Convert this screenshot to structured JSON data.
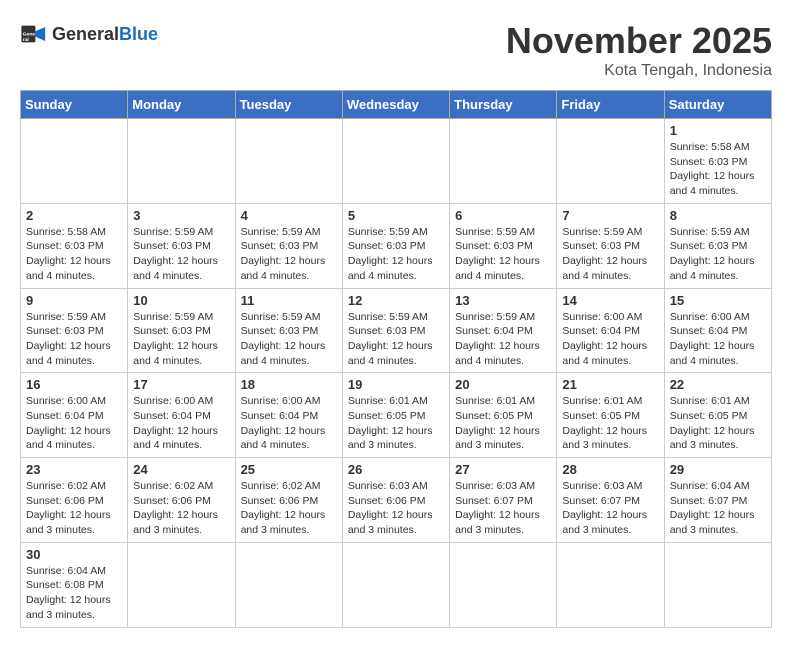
{
  "logo": {
    "text_general": "General",
    "text_blue": "Blue"
  },
  "title": "November 2025",
  "subtitle": "Kota Tengah, Indonesia",
  "days_of_week": [
    "Sunday",
    "Monday",
    "Tuesday",
    "Wednesday",
    "Thursday",
    "Friday",
    "Saturday"
  ],
  "weeks": [
    [
      {
        "day": "",
        "info": ""
      },
      {
        "day": "",
        "info": ""
      },
      {
        "day": "",
        "info": ""
      },
      {
        "day": "",
        "info": ""
      },
      {
        "day": "",
        "info": ""
      },
      {
        "day": "",
        "info": ""
      },
      {
        "day": "1",
        "info": "Sunrise: 5:58 AM\nSunset: 6:03 PM\nDaylight: 12 hours and 4 minutes."
      }
    ],
    [
      {
        "day": "2",
        "info": "Sunrise: 5:58 AM\nSunset: 6:03 PM\nDaylight: 12 hours and 4 minutes."
      },
      {
        "day": "3",
        "info": "Sunrise: 5:59 AM\nSunset: 6:03 PM\nDaylight: 12 hours and 4 minutes."
      },
      {
        "day": "4",
        "info": "Sunrise: 5:59 AM\nSunset: 6:03 PM\nDaylight: 12 hours and 4 minutes."
      },
      {
        "day": "5",
        "info": "Sunrise: 5:59 AM\nSunset: 6:03 PM\nDaylight: 12 hours and 4 minutes."
      },
      {
        "day": "6",
        "info": "Sunrise: 5:59 AM\nSunset: 6:03 PM\nDaylight: 12 hours and 4 minutes."
      },
      {
        "day": "7",
        "info": "Sunrise: 5:59 AM\nSunset: 6:03 PM\nDaylight: 12 hours and 4 minutes."
      },
      {
        "day": "8",
        "info": "Sunrise: 5:59 AM\nSunset: 6:03 PM\nDaylight: 12 hours and 4 minutes."
      }
    ],
    [
      {
        "day": "9",
        "info": "Sunrise: 5:59 AM\nSunset: 6:03 PM\nDaylight: 12 hours and 4 minutes."
      },
      {
        "day": "10",
        "info": "Sunrise: 5:59 AM\nSunset: 6:03 PM\nDaylight: 12 hours and 4 minutes."
      },
      {
        "day": "11",
        "info": "Sunrise: 5:59 AM\nSunset: 6:03 PM\nDaylight: 12 hours and 4 minutes."
      },
      {
        "day": "12",
        "info": "Sunrise: 5:59 AM\nSunset: 6:03 PM\nDaylight: 12 hours and 4 minutes."
      },
      {
        "day": "13",
        "info": "Sunrise: 5:59 AM\nSunset: 6:04 PM\nDaylight: 12 hours and 4 minutes."
      },
      {
        "day": "14",
        "info": "Sunrise: 6:00 AM\nSunset: 6:04 PM\nDaylight: 12 hours and 4 minutes."
      },
      {
        "day": "15",
        "info": "Sunrise: 6:00 AM\nSunset: 6:04 PM\nDaylight: 12 hours and 4 minutes."
      }
    ],
    [
      {
        "day": "16",
        "info": "Sunrise: 6:00 AM\nSunset: 6:04 PM\nDaylight: 12 hours and 4 minutes."
      },
      {
        "day": "17",
        "info": "Sunrise: 6:00 AM\nSunset: 6:04 PM\nDaylight: 12 hours and 4 minutes."
      },
      {
        "day": "18",
        "info": "Sunrise: 6:00 AM\nSunset: 6:04 PM\nDaylight: 12 hours and 4 minutes."
      },
      {
        "day": "19",
        "info": "Sunrise: 6:01 AM\nSunset: 6:05 PM\nDaylight: 12 hours and 3 minutes."
      },
      {
        "day": "20",
        "info": "Sunrise: 6:01 AM\nSunset: 6:05 PM\nDaylight: 12 hours and 3 minutes."
      },
      {
        "day": "21",
        "info": "Sunrise: 6:01 AM\nSunset: 6:05 PM\nDaylight: 12 hours and 3 minutes."
      },
      {
        "day": "22",
        "info": "Sunrise: 6:01 AM\nSunset: 6:05 PM\nDaylight: 12 hours and 3 minutes."
      }
    ],
    [
      {
        "day": "23",
        "info": "Sunrise: 6:02 AM\nSunset: 6:06 PM\nDaylight: 12 hours and 3 minutes."
      },
      {
        "day": "24",
        "info": "Sunrise: 6:02 AM\nSunset: 6:06 PM\nDaylight: 12 hours and 3 minutes."
      },
      {
        "day": "25",
        "info": "Sunrise: 6:02 AM\nSunset: 6:06 PM\nDaylight: 12 hours and 3 minutes."
      },
      {
        "day": "26",
        "info": "Sunrise: 6:03 AM\nSunset: 6:06 PM\nDaylight: 12 hours and 3 minutes."
      },
      {
        "day": "27",
        "info": "Sunrise: 6:03 AM\nSunset: 6:07 PM\nDaylight: 12 hours and 3 minutes."
      },
      {
        "day": "28",
        "info": "Sunrise: 6:03 AM\nSunset: 6:07 PM\nDaylight: 12 hours and 3 minutes."
      },
      {
        "day": "29",
        "info": "Sunrise: 6:04 AM\nSunset: 6:07 PM\nDaylight: 12 hours and 3 minutes."
      }
    ],
    [
      {
        "day": "30",
        "info": "Sunrise: 6:04 AM\nSunset: 6:08 PM\nDaylight: 12 hours and 3 minutes."
      },
      {
        "day": "",
        "info": ""
      },
      {
        "day": "",
        "info": ""
      },
      {
        "day": "",
        "info": ""
      },
      {
        "day": "",
        "info": ""
      },
      {
        "day": "",
        "info": ""
      },
      {
        "day": "",
        "info": ""
      }
    ]
  ]
}
